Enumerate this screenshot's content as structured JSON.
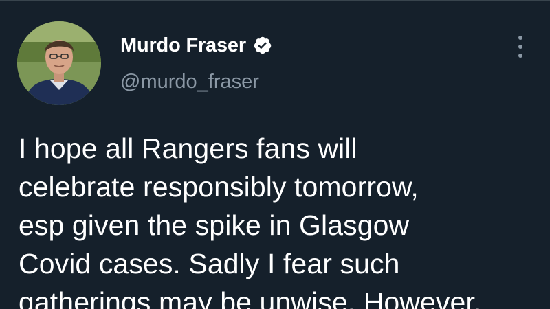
{
  "tweet": {
    "author": {
      "display_name": "Murdo Fraser",
      "handle": "@murdo_fraser",
      "verified": true,
      "avatar_icon": "profile-photo"
    },
    "more_icon": "more-vertical-icon",
    "text_lines": [
      "I hope all Rangers fans will",
      "celebrate responsibly tomorrow,",
      "esp given the spike in Glasgow",
      "Covid cases. Sadly I fear such",
      "gatherings may be unwise. However,"
    ]
  },
  "colors": {
    "background": "#15202b",
    "primary_text": "#ffffff",
    "secondary_text": "#8b98a5",
    "border": "#38444d"
  }
}
